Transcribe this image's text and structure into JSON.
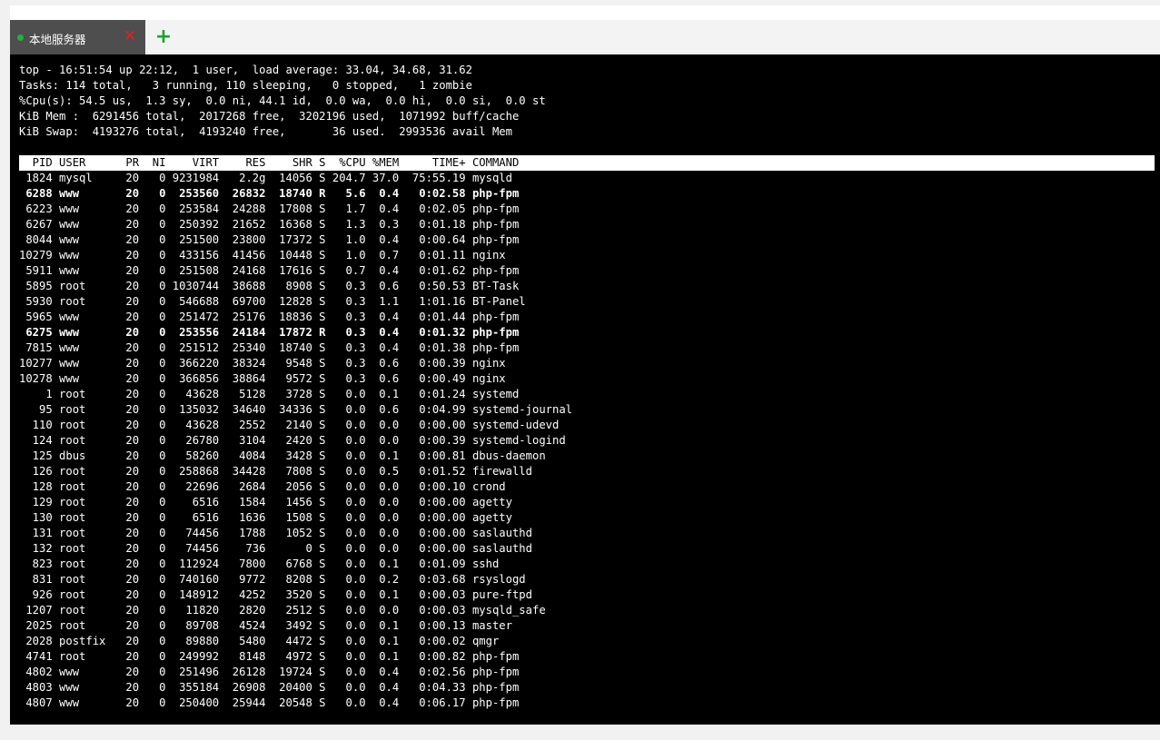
{
  "tabs": [
    {
      "label": "本地服务器",
      "status_color": "#20b23c",
      "close_icon": "close-icon"
    }
  ],
  "add_tab_icon": "plus-icon",
  "terminal": {
    "lines": [
      {
        "text": "top - 16:51:54 up 22:12,  1 user,  load average: 33.04, 34.68, 31.62",
        "style": "plain"
      },
      {
        "text": "Tasks: 114 total,   3 running, 110 sleeping,   0 stopped,   1 zombie",
        "style": "plain"
      },
      {
        "text": "%Cpu(s): 54.5 us,  1.3 sy,  0.0 ni, 44.1 id,  0.0 wa,  0.0 hi,  0.0 si,  0.0 st",
        "style": "plain"
      },
      {
        "text": "KiB Mem :  6291456 total,  2017268 free,  3202196 used,  1071992 buff/cache",
        "style": "plain"
      },
      {
        "text": "KiB Swap:  4193276 total,  4193240 free,       36 used.  2993536 avail Mem",
        "style": "plain"
      },
      {
        "text": "",
        "style": "plain"
      },
      {
        "text": "  PID USER      PR  NI    VIRT    RES    SHR S  %CPU %MEM     TIME+ COMMAND",
        "style": "header"
      },
      {
        "text": " 1824 mysql     20   0 9231984   2.2g  14056 S 204.7 37.0  75:55.19 mysqld",
        "style": "plain"
      },
      {
        "text": " 6288 www       20   0  253560  26832  18740 R   5.6  0.4   0:02.58 php-fpm",
        "style": "bold"
      },
      {
        "text": " 6223 www       20   0  253584  24288  17808 S   1.7  0.4   0:02.05 php-fpm",
        "style": "plain"
      },
      {
        "text": " 6267 www       20   0  250392  21652  16368 S   1.3  0.3   0:01.18 php-fpm",
        "style": "plain"
      },
      {
        "text": " 8044 www       20   0  251500  23800  17372 S   1.0  0.4   0:00.64 php-fpm",
        "style": "plain"
      },
      {
        "text": "10279 www       20   0  433156  41456  10448 S   1.0  0.7   0:01.11 nginx",
        "style": "plain"
      },
      {
        "text": " 5911 www       20   0  251508  24168  17616 S   0.7  0.4   0:01.62 php-fpm",
        "style": "plain"
      },
      {
        "text": " 5895 root      20   0 1030744  38688   8908 S   0.3  0.6   0:50.53 BT-Task",
        "style": "plain"
      },
      {
        "text": " 5930 root      20   0  546688  69700  12828 S   0.3  1.1   1:01.16 BT-Panel",
        "style": "plain"
      },
      {
        "text": " 5965 www       20   0  251472  25176  18836 S   0.3  0.4   0:01.44 php-fpm",
        "style": "plain"
      },
      {
        "text": " 6275 www       20   0  253556  24184  17872 R   0.3  0.4   0:01.32 php-fpm",
        "style": "bold"
      },
      {
        "text": " 7815 www       20   0  251512  25340  18740 S   0.3  0.4   0:01.38 php-fpm",
        "style": "plain"
      },
      {
        "text": "10277 www       20   0  366220  38324   9548 S   0.3  0.6   0:00.39 nginx",
        "style": "plain"
      },
      {
        "text": "10278 www       20   0  366856  38864   9572 S   0.3  0.6   0:00.49 nginx",
        "style": "plain"
      },
      {
        "text": "    1 root      20   0   43628   5128   3728 S   0.0  0.1   0:01.24 systemd",
        "style": "plain"
      },
      {
        "text": "   95 root      20   0  135032  34640  34336 S   0.0  0.6   0:04.99 systemd-journal",
        "style": "plain"
      },
      {
        "text": "  110 root      20   0   43628   2552   2140 S   0.0  0.0   0:00.00 systemd-udevd",
        "style": "plain"
      },
      {
        "text": "  124 root      20   0   26780   3104   2420 S   0.0  0.0   0:00.39 systemd-logind",
        "style": "plain"
      },
      {
        "text": "  125 dbus      20   0   58260   4084   3428 S   0.0  0.1   0:00.81 dbus-daemon",
        "style": "plain"
      },
      {
        "text": "  126 root      20   0  258868  34428   7808 S   0.0  0.5   0:01.52 firewalld",
        "style": "plain"
      },
      {
        "text": "  128 root      20   0   22696   2684   2056 S   0.0  0.0   0:00.10 crond",
        "style": "plain"
      },
      {
        "text": "  129 root      20   0    6516   1584   1456 S   0.0  0.0   0:00.00 agetty",
        "style": "plain"
      },
      {
        "text": "  130 root      20   0    6516   1636   1508 S   0.0  0.0   0:00.00 agetty",
        "style": "plain"
      },
      {
        "text": "  131 root      20   0   74456   1788   1052 S   0.0  0.0   0:00.00 saslauthd",
        "style": "plain"
      },
      {
        "text": "  132 root      20   0   74456    736      0 S   0.0  0.0   0:00.00 saslauthd",
        "style": "plain"
      },
      {
        "text": "  823 root      20   0  112924   7800   6768 S   0.0  0.1   0:01.09 sshd",
        "style": "plain"
      },
      {
        "text": "  831 root      20   0  740160   9772   8208 S   0.0  0.2   0:03.68 rsyslogd",
        "style": "plain"
      },
      {
        "text": "  926 root      20   0  148912   4252   3520 S   0.0  0.1   0:00.03 pure-ftpd",
        "style": "plain"
      },
      {
        "text": " 1207 root      20   0   11820   2820   2512 S   0.0  0.0   0:00.03 mysqld_safe",
        "style": "plain"
      },
      {
        "text": " 2025 root      20   0   89708   4524   3492 S   0.0  0.1   0:00.13 master",
        "style": "plain"
      },
      {
        "text": " 2028 postfix   20   0   89880   5480   4472 S   0.0  0.1   0:00.02 qmgr",
        "style": "plain"
      },
      {
        "text": " 4741 root      20   0  249992   8148   4972 S   0.0  0.1   0:00.82 php-fpm",
        "style": "plain"
      },
      {
        "text": " 4802 www       20   0  251496  26128  19724 S   0.0  0.4   0:02.56 php-fpm",
        "style": "plain"
      },
      {
        "text": " 4803 www       20   0  355184  26908  20400 S   0.0  0.4   0:04.33 php-fpm",
        "style": "plain"
      },
      {
        "text": " 4807 www       20   0  250400  25944  20548 S   0.0  0.4   0:06.17 php-fpm",
        "style": "plain"
      }
    ]
  }
}
